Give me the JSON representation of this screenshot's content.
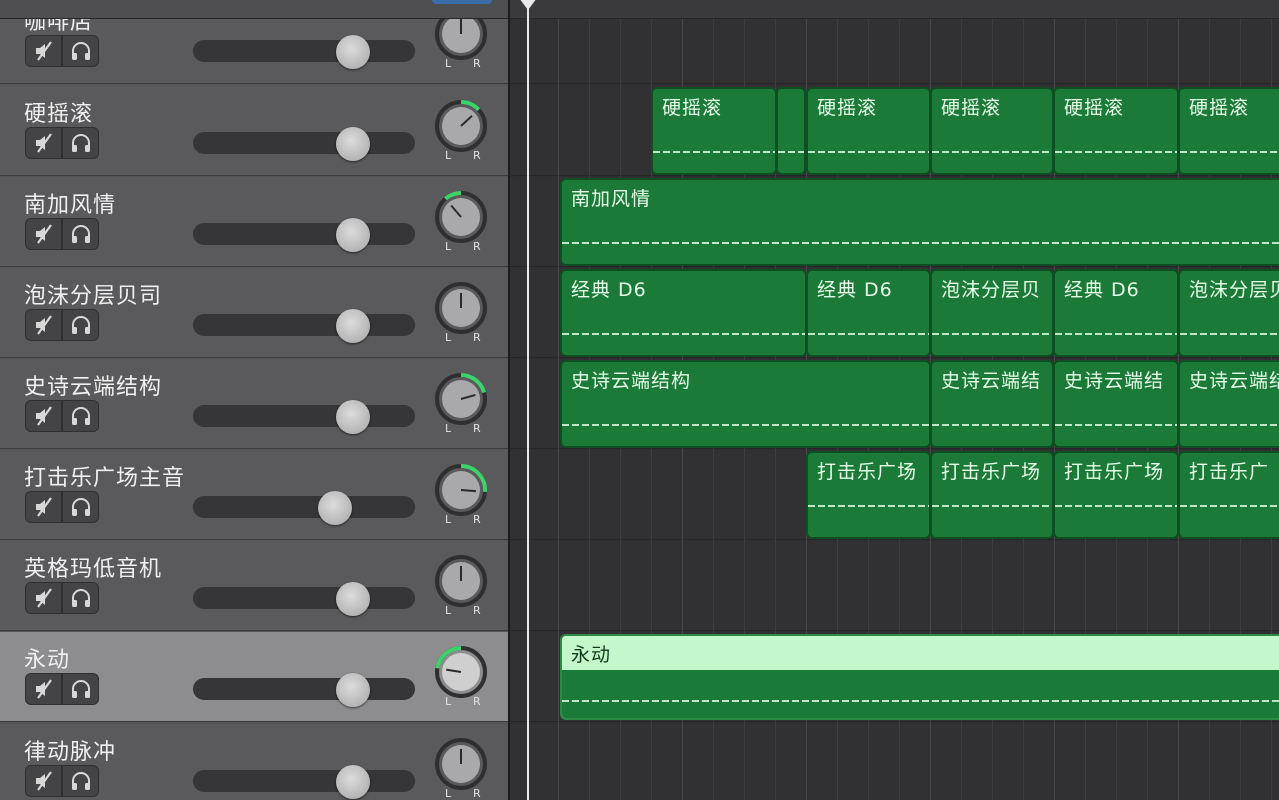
{
  "colors": {
    "region_green": "#1c7a38",
    "region_selected": "#c0f5c6",
    "pan_accent": "#3dd36b",
    "track_bg": "#5a5a5c",
    "track_selected_bg": "#8d8d8f"
  },
  "pan_labels": {
    "left": "L",
    "right": "R"
  },
  "tracks": [
    {
      "name": "咖啡店",
      "volume": 0.72,
      "pan": 0.0,
      "selected": false,
      "partial": true
    },
    {
      "name": "硬摇滚",
      "volume": 0.72,
      "pan": 0.35,
      "selected": false
    },
    {
      "name": "南加风情",
      "volume": 0.72,
      "pan": -0.3,
      "selected": false
    },
    {
      "name": "泡沫分层贝司",
      "volume": 0.72,
      "pan": 0.0,
      "selected": false
    },
    {
      "name": "史诗云端结构",
      "volume": 0.72,
      "pan": 0.55,
      "selected": false
    },
    {
      "name": "打击乐广场主音",
      "volume": 0.64,
      "pan": 0.7,
      "selected": false
    },
    {
      "name": "英格玛低音机",
      "volume": 0.72,
      "pan": 0.0,
      "selected": false
    },
    {
      "name": "永动",
      "volume": 0.72,
      "pan": -0.6,
      "selected": true
    },
    {
      "name": "律动脉冲",
      "volume": 0.72,
      "pan": 0.0,
      "selected": false,
      "partial": true
    }
  ],
  "regions": {
    "track1": [
      "硬摇滚",
      "",
      "硬摇滚",
      "硬摇滚",
      "硬摇滚",
      "硬摇滚"
    ],
    "track2": [
      "南加风情"
    ],
    "track3": [
      "经典 D6",
      "经典 D6",
      "泡沫分层贝",
      "经典 D6",
      "泡沫分层贝"
    ],
    "track4": [
      "史诗云端结构",
      "史诗云端结",
      "史诗云端结",
      "史诗云端结"
    ],
    "track5": [
      "打击乐广场",
      "打击乐广场",
      "打击乐广场",
      "打击乐广"
    ],
    "track7": [
      "永动"
    ]
  }
}
